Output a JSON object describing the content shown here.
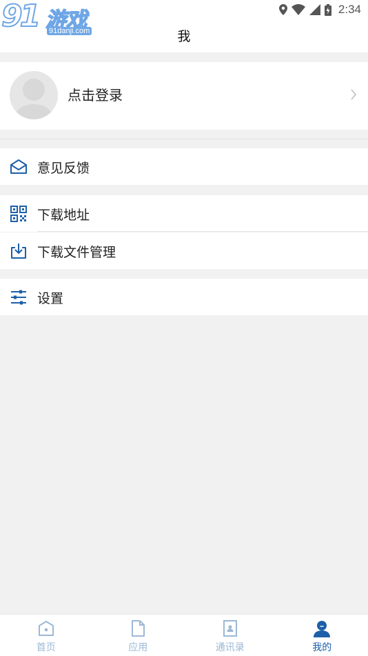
{
  "status_bar": {
    "time": "2:34"
  },
  "watermark": {
    "number": "91",
    "name": "游戏",
    "url": "91danji.com"
  },
  "header": {
    "title": "我"
  },
  "profile": {
    "login_label": "点击登录"
  },
  "menu": {
    "feedback": "意见反馈",
    "download_address": "下载地址",
    "download_manager": "下载文件管理",
    "settings": "设置"
  },
  "bottom_nav": [
    {
      "label": "首页",
      "icon": "home-icon",
      "active": false
    },
    {
      "label": "应用",
      "icon": "document-icon",
      "active": false
    },
    {
      "label": "通讯录",
      "icon": "contacts-icon",
      "active": false
    },
    {
      "label": "我的",
      "icon": "person-icon",
      "active": true
    }
  ],
  "colors": {
    "accent": "#1d5fa8",
    "inactive": "#9bb8d6",
    "background": "#f1f1f1"
  }
}
